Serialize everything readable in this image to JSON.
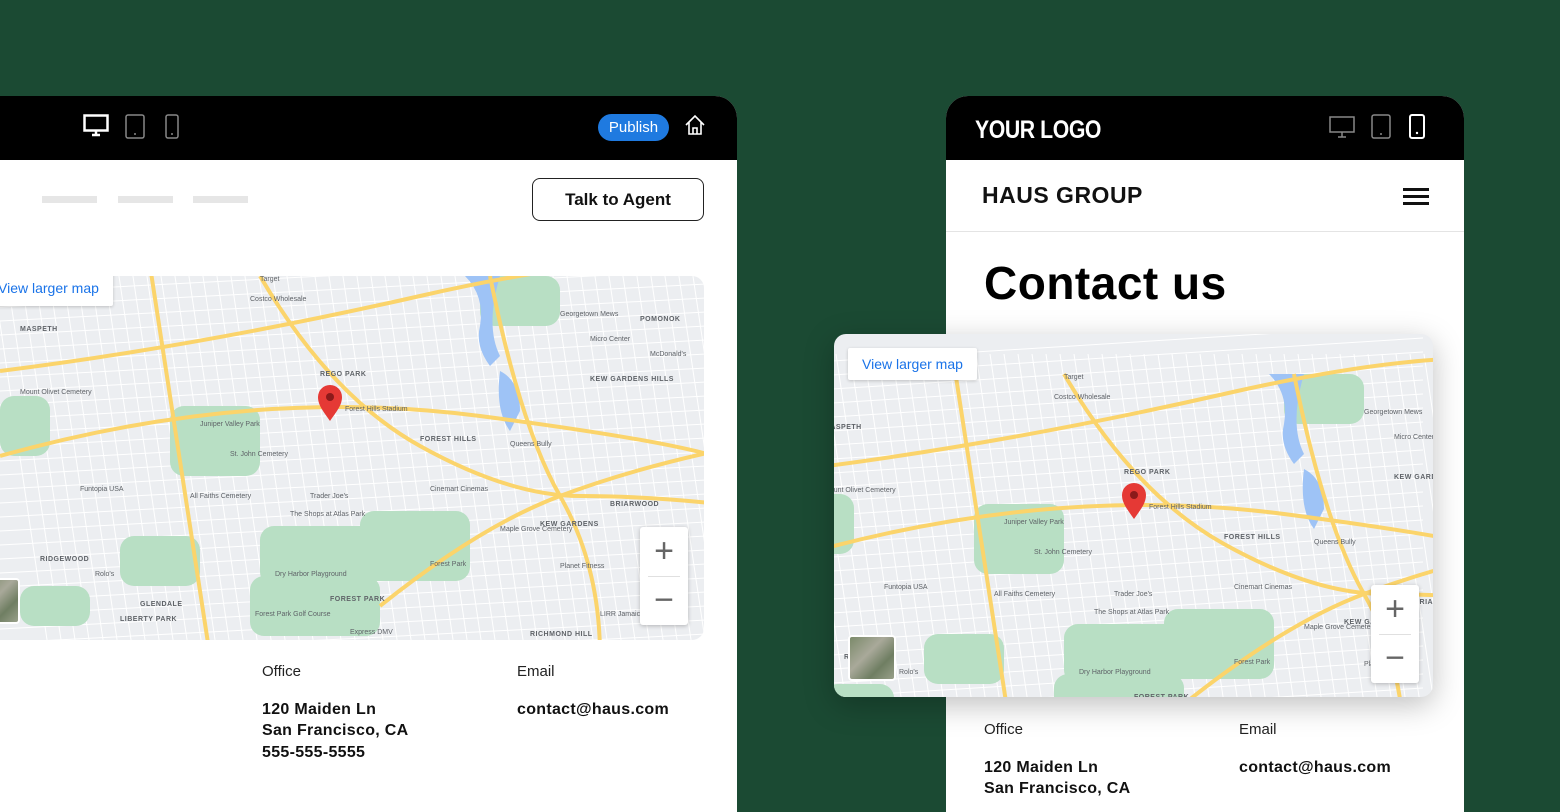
{
  "colors": {
    "background": "#1b4a33",
    "publish": "#1f7ae0",
    "map_link": "#1a73e8",
    "park": "#b8dfc4",
    "road": "#fbd46b",
    "water": "#9ec3f6",
    "pin": "#e53935"
  },
  "editor_desktop": {
    "device_icons": [
      "desktop-icon",
      "tablet-icon",
      "mobile-icon"
    ],
    "active_device": "desktop",
    "publish_label": "Publish",
    "home_icon": "home-icon",
    "cta_label": "Talk to Agent",
    "map": {
      "view_larger": "View larger map",
      "zoom_in": "+",
      "zoom_out": "−"
    },
    "office_label": "Office",
    "office_lines": [
      "120 Maiden Ln",
      "San Francisco, CA",
      "555-555-5555"
    ],
    "email_label": "Email",
    "email": "contact@haus.com"
  },
  "editor_mobile": {
    "logo": "YOUR LOGO",
    "device_icons": [
      "desktop-icon",
      "tablet-icon",
      "mobile-icon"
    ],
    "active_device": "mobile",
    "brand": "HAUS GROUP",
    "menu_icon": "hamburger-menu-icon",
    "title": "Contact us",
    "map": {
      "view_larger": "View larger map",
      "zoom_in": "+",
      "zoom_out": "−"
    },
    "office_label": "Office",
    "office_lines": [
      "120 Maiden Ln",
      "San Francisco, CA"
    ],
    "email_label": "Email",
    "email": "contact@haus.com"
  },
  "map_labels": [
    "MASPETH",
    "REGO PARK",
    "FOREST HILLS",
    "KEW GARDENS",
    "RIDGEWOOD",
    "GLENDALE",
    "LIBERTY PARK",
    "FOREST PARK",
    "RICHMOND HILL",
    "BRIARWOOD",
    "POMONOK",
    "KEW GARDENS HILLS",
    "Forest Hills Stadium",
    "St. John Cemetery",
    "All Faiths Cemetery",
    "Mount Olivet Cemetery",
    "Trader Joe's",
    "The Shops at Atlas Park",
    "Cinemart Cinemas",
    "Costco Wholesale",
    "Target",
    "Georgetown Mews",
    "Micro Center",
    "McDonald's",
    "Queens Bully",
    "Forest Park",
    "Maple Grove Cemetery",
    "Planet Fitness",
    "Funtopia USA",
    "Rolo's",
    "Dry Harbor Playground",
    "Forest Park Golf Course",
    "Juniper Valley Park",
    "Express DMV",
    "LIRR Jamaica Yard"
  ]
}
